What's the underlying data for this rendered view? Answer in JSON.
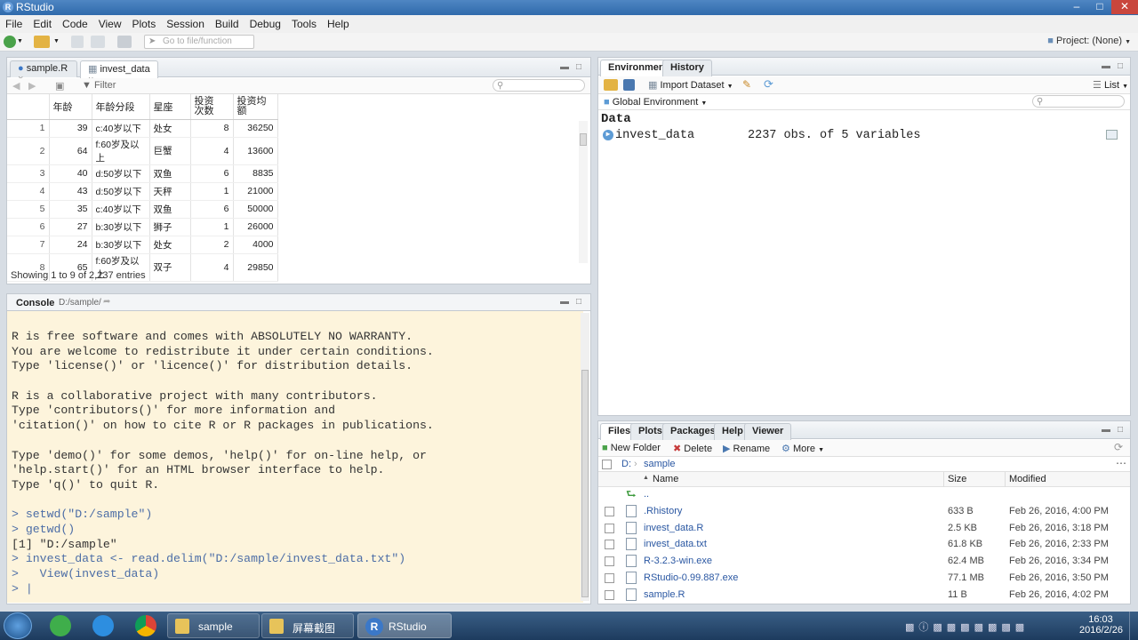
{
  "window": {
    "title": "RStudio",
    "app_icon": "R"
  },
  "menu": [
    "File",
    "Edit",
    "Code",
    "View",
    "Plots",
    "Session",
    "Build",
    "Debug",
    "Tools",
    "Help"
  ],
  "toolbar": {
    "goto_placeholder": "Go to file/function",
    "project": "Project: (None)"
  },
  "source": {
    "tabs": [
      {
        "label": "sample.R"
      },
      {
        "label": "invest_data"
      }
    ],
    "filter_label": "Filter",
    "columns": [
      "",
      "年龄",
      "年龄分段",
      "星座",
      "投资次数",
      "投资均额"
    ],
    "rows": [
      [
        "1",
        "39",
        "c:40岁以下",
        "处女",
        "8",
        "36250"
      ],
      [
        "2",
        "64",
        "f:60岁及以上",
        "巨蟹",
        "4",
        "13600"
      ],
      [
        "3",
        "40",
        "d:50岁以下",
        "双鱼",
        "6",
        "8835"
      ],
      [
        "4",
        "43",
        "d:50岁以下",
        "天秤",
        "1",
        "21000"
      ],
      [
        "5",
        "35",
        "c:40岁以下",
        "双鱼",
        "6",
        "50000"
      ],
      [
        "6",
        "27",
        "b:30岁以下",
        "狮子",
        "1",
        "26000"
      ],
      [
        "7",
        "24",
        "b:30岁以下",
        "处女",
        "2",
        "4000"
      ],
      [
        "8",
        "65",
        "f:60岁及以上",
        "双子",
        "4",
        "29850"
      ]
    ],
    "status": "Showing 1 to 9 of 2,237 entries"
  },
  "console": {
    "label": "Console",
    "path": "D:/sample/",
    "lines": [
      {
        "text": "R is free software and comes with ABSOLUTELY NO WARRANTY.",
        "type": "out"
      },
      {
        "text": "You are welcome to redistribute it under certain conditions.",
        "type": "out"
      },
      {
        "text": "Type 'license()' or 'licence()' for distribution details.",
        "type": "out"
      },
      {
        "text": "",
        "type": "out"
      },
      {
        "text": "R is a collaborative project with many contributors.",
        "type": "out"
      },
      {
        "text": "Type 'contributors()' for more information and",
        "type": "out"
      },
      {
        "text": "'citation()' on how to cite R or R packages in publications.",
        "type": "out"
      },
      {
        "text": "",
        "type": "out"
      },
      {
        "text": "Type 'demo()' for some demos, 'help()' for on-line help, or",
        "type": "out"
      },
      {
        "text": "'help.start()' for an HTML browser interface to help.",
        "type": "out"
      },
      {
        "text": "Type 'q()' to quit R.",
        "type": "out"
      },
      {
        "text": "",
        "type": "out"
      },
      {
        "text": "> setwd(\"D:/sample\")",
        "type": "cmd"
      },
      {
        "text": "> getwd()",
        "type": "cmd"
      },
      {
        "text": "[1] \"D:/sample\"",
        "type": "out"
      },
      {
        "text": "> invest_data <- read.delim(\"D:/sample/invest_data.txt\")",
        "type": "cmd"
      },
      {
        "text": ">   View(invest_data)",
        "type": "cmd"
      },
      {
        "text": "> |",
        "type": "cmd"
      }
    ]
  },
  "environment": {
    "tabs": [
      "Environment",
      "History"
    ],
    "import_label": "Import Dataset",
    "view_mode": "List",
    "scope": "Global Environment",
    "section": "Data",
    "items": [
      {
        "name": "invest_data",
        "value": "2237 obs. of 5 variables"
      }
    ]
  },
  "files": {
    "tabs": [
      "Files",
      "Plots",
      "Packages",
      "Help",
      "Viewer"
    ],
    "actions": {
      "new_folder": "New Folder",
      "delete": "Delete",
      "rename": "Rename",
      "more": "More"
    },
    "breadcrumb": [
      "D:",
      "sample"
    ],
    "headers": {
      "name": "Name",
      "size": "Size",
      "modified": "Modified"
    },
    "parent": "..",
    "rows": [
      {
        "name": ".Rhistory",
        "size": "633 B",
        "modified": "Feb 26, 2016, 4:00 PM"
      },
      {
        "name": "invest_data.R",
        "size": "2.5 KB",
        "modified": "Feb 26, 2016, 3:18 PM"
      },
      {
        "name": "invest_data.txt",
        "size": "61.8 KB",
        "modified": "Feb 26, 2016, 2:33 PM"
      },
      {
        "name": "R-3.2.3-win.exe",
        "size": "62.4 MB",
        "modified": "Feb 26, 2016, 3:34 PM"
      },
      {
        "name": "RStudio-0.99.887.exe",
        "size": "77.1 MB",
        "modified": "Feb 26, 2016, 3:50 PM"
      },
      {
        "name": "sample.R",
        "size": "11 B",
        "modified": "Feb 26, 2016, 4:02 PM"
      }
    ]
  },
  "taskbar": {
    "tasks": [
      {
        "label": "sample"
      },
      {
        "label": "屏幕截图"
      },
      {
        "label": "RStudio"
      }
    ],
    "time": "16:03",
    "date": "2016/2/26"
  },
  "colors": {
    "titlebar": "#3b75b8",
    "console_bg": "#fdf4dc",
    "link": "#2a57a2",
    "taskbar": "#2a4a6e"
  }
}
